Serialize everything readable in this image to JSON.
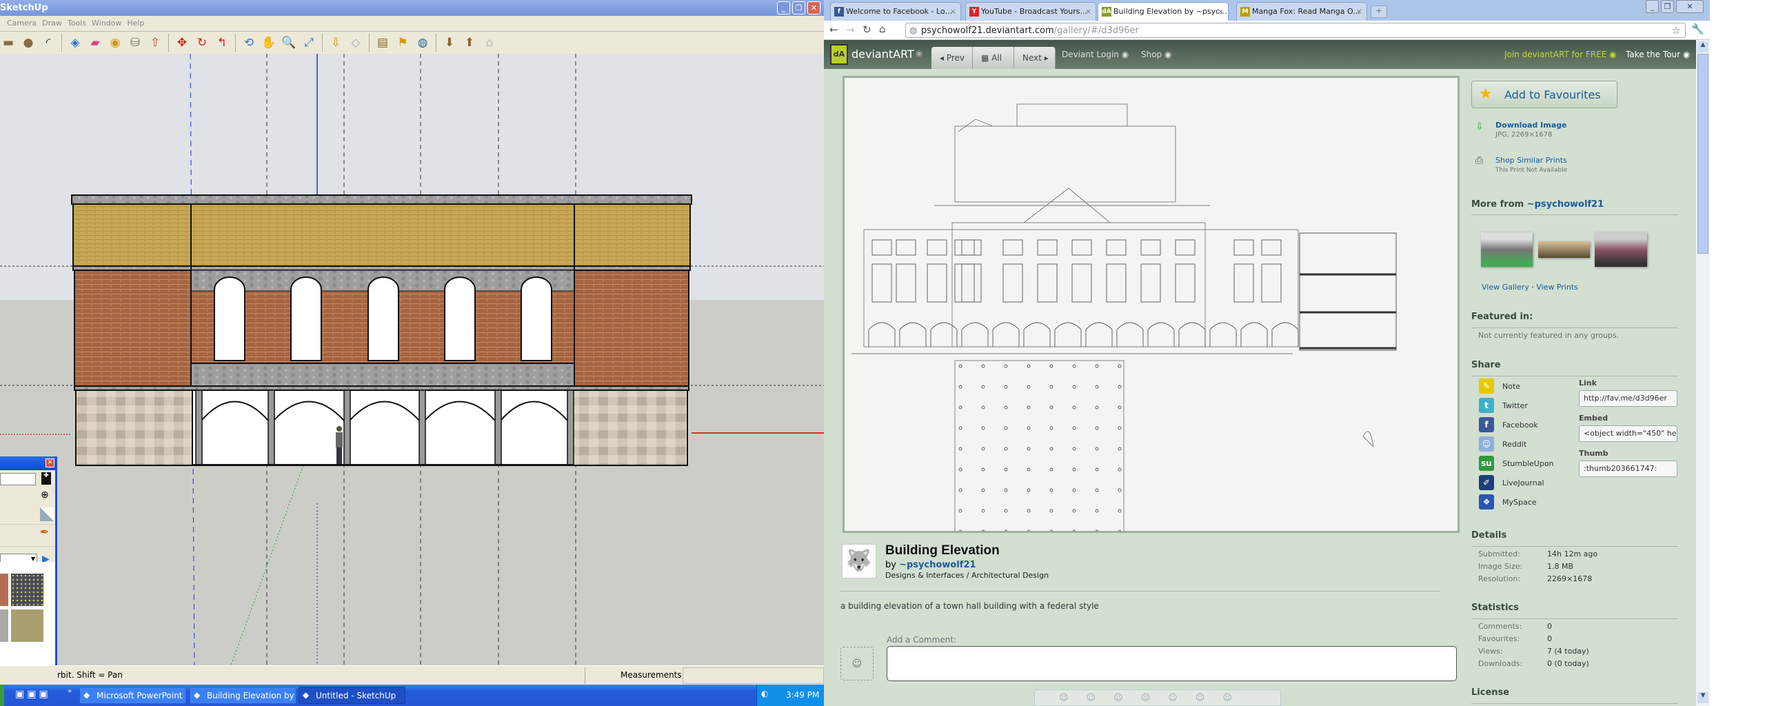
{
  "sketchup": {
    "title": "SketchUp",
    "menu": [
      "Camera",
      "Draw",
      "Tools",
      "Window",
      "Help"
    ],
    "toolbar_icons": [
      "rectangle-icon",
      "circle-icon",
      "arc-icon",
      "make-component-icon",
      "eraser-icon",
      "tape-measure-icon",
      "paint-bucket-icon",
      "push-pull-icon",
      "move-icon",
      "rotate-icon",
      "follow-me-icon",
      "orbit-icon",
      "pan-icon",
      "zoom-icon",
      "zoom-extents-icon",
      "get-models-icon",
      "share-model-icon",
      "place-model-icon",
      "add-location-icon",
      "preview-google-earth-icon",
      "get-component-icon",
      "share-component-icon",
      "warehouse-icon"
    ],
    "status_hint": "rbit.  Shift = Pan",
    "measurements_label": "Measurements",
    "measurements_value": ""
  },
  "taskbar": {
    "items": [
      {
        "label": "Microsoft PowerPoint ...",
        "icon": "powerpoint-icon"
      },
      {
        "label": "Building Elevation by ...",
        "icon": "chrome-icon"
      },
      {
        "label": "Untitled - SketchUp",
        "icon": "sketchup-icon",
        "active": true
      }
    ],
    "clock": "3:49 PM"
  },
  "browser": {
    "tabs": [
      {
        "label": "Welcome to Facebook - Lo...",
        "icon": "facebook-icon",
        "fav": "f",
        "color": "#3b5998"
      },
      {
        "label": "YouTube - Broadcast Yours...",
        "icon": "youtube-icon",
        "fav": "Y",
        "color": "#d22"
      },
      {
        "label": "Building Elevation by ~psyc...",
        "icon": "deviantart-icon",
        "fav": "dA",
        "color": "#8a9a2a",
        "active": true
      },
      {
        "label": "Manga Fox: Read Manga O...",
        "icon": "mangafox-icon",
        "fav": "M",
        "color": "#b8a000"
      }
    ],
    "url_host": "psychowolf21.deviantart.com",
    "url_path": "/gallery/#/d3d96er"
  },
  "da_header": {
    "logo": "deviantART",
    "prev": "Prev",
    "all": "All",
    "next": "Next",
    "login": "Deviant Login",
    "shop": "Shop",
    "join": "Join deviantART for FREE",
    "tour": "Take the Tour"
  },
  "deviation": {
    "title": "Building Elevation",
    "by": "by",
    "author": "~psychowolf21",
    "category": "Designs & Interfaces / Architectural Design",
    "description": "a building elevation of a town hall building with a federal style",
    "comment_label": "Add a Comment:",
    "comment_value": ""
  },
  "sidebar": {
    "favourite": "Add to Favourites",
    "download": "Download Image",
    "download_meta": "JPG, 2269×1678",
    "shop": "Shop Similar Prints",
    "shop_meta": "This Print Not Available",
    "more_from": "More from",
    "more_from_user": "~psychowolf21",
    "view_gallery": "View Gallery",
    "sep": "·",
    "view_prints": "View Prints",
    "featured_title": "Featured in:",
    "featured_text": "Not currently featured in any groups.",
    "share_title": "Share",
    "share": [
      {
        "label": "Note",
        "icon": "note-icon",
        "color": "#e8c800",
        "g": "✎"
      },
      {
        "label": "Twitter",
        "icon": "twitter-icon",
        "color": "#3fb0c8",
        "g": "t"
      },
      {
        "label": "Facebook",
        "icon": "facebook-icon",
        "color": "#3b5998",
        "g": "f"
      },
      {
        "label": "Reddit",
        "icon": "reddit-icon",
        "color": "#8fb0d8",
        "g": "☺"
      },
      {
        "label": "StumbleUpon",
        "icon": "stumbleupon-icon",
        "color": "#2c9a3c",
        "g": "su"
      },
      {
        "label": "LiveJournal",
        "icon": "livejournal-icon",
        "color": "#1d3f7a",
        "g": "✐"
      },
      {
        "label": "MySpace",
        "icon": "myspace-icon",
        "color": "#2a55b0",
        "g": "❖"
      }
    ],
    "link_label": "Link",
    "link_value": "http://fav.me/d3d96er",
    "embed_label": "Embed",
    "embed_value": "<object width=\"450\" height",
    "thumb_label": "Thumb",
    "thumb_value": ":thumb203661747:",
    "details_title": "Details",
    "details": [
      {
        "k": "Submitted:",
        "v": "14h 12m ago"
      },
      {
        "k": "Image Size:",
        "v": "1.8 MB"
      },
      {
        "k": "Resolution:",
        "v": "2269×1678"
      }
    ],
    "stats_title": "Statistics",
    "stats": [
      {
        "k": "Comments:",
        "v": "0"
      },
      {
        "k": "Favourites:",
        "v": "0"
      },
      {
        "k": "Views:",
        "v": "7 (4 today)"
      },
      {
        "k": "Downloads:",
        "v": "0 (0 today)"
      }
    ],
    "license_title": "License"
  }
}
